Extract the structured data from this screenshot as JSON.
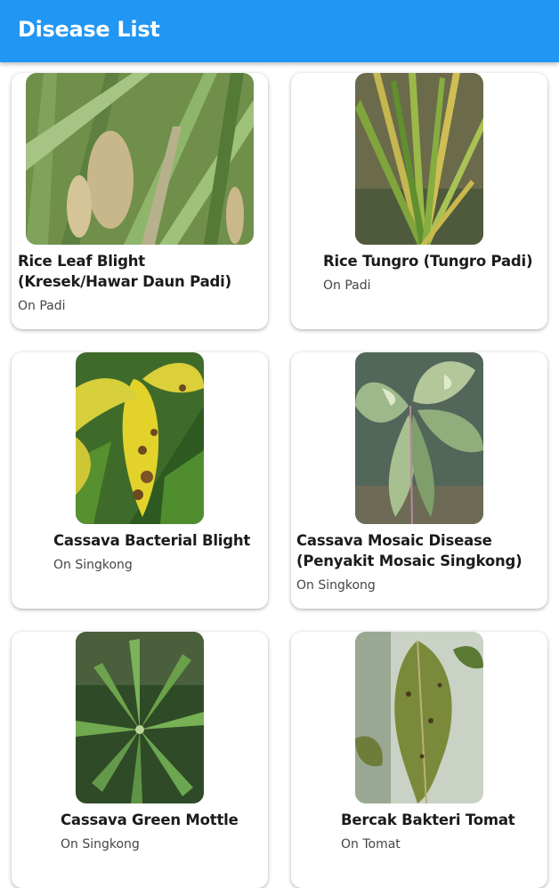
{
  "appbar": {
    "title": "Disease List"
  },
  "diseases": [
    {
      "name": "Rice Leaf Blight (Kresek/Hawar Daun Padi)",
      "plant": "On Padi"
    },
    {
      "name": "Rice Tungro (Tungro Padi)",
      "plant": "On Padi"
    },
    {
      "name": "Cassava Bacterial Blight",
      "plant": "On Singkong"
    },
    {
      "name": "Cassava Mosaic Disease (Penyakit Mosaic Singkong)",
      "plant": "On Singkong"
    },
    {
      "name": "Cassava Green Mottle",
      "plant": "On Singkong"
    },
    {
      "name": "Bercak Bakteri Tomat",
      "plant": "On Tomat"
    }
  ],
  "colors": {
    "primary": "#2196f3",
    "card_background": "#ffffff",
    "title_text": "#1b1b1b",
    "subtitle_text": "#454545"
  }
}
